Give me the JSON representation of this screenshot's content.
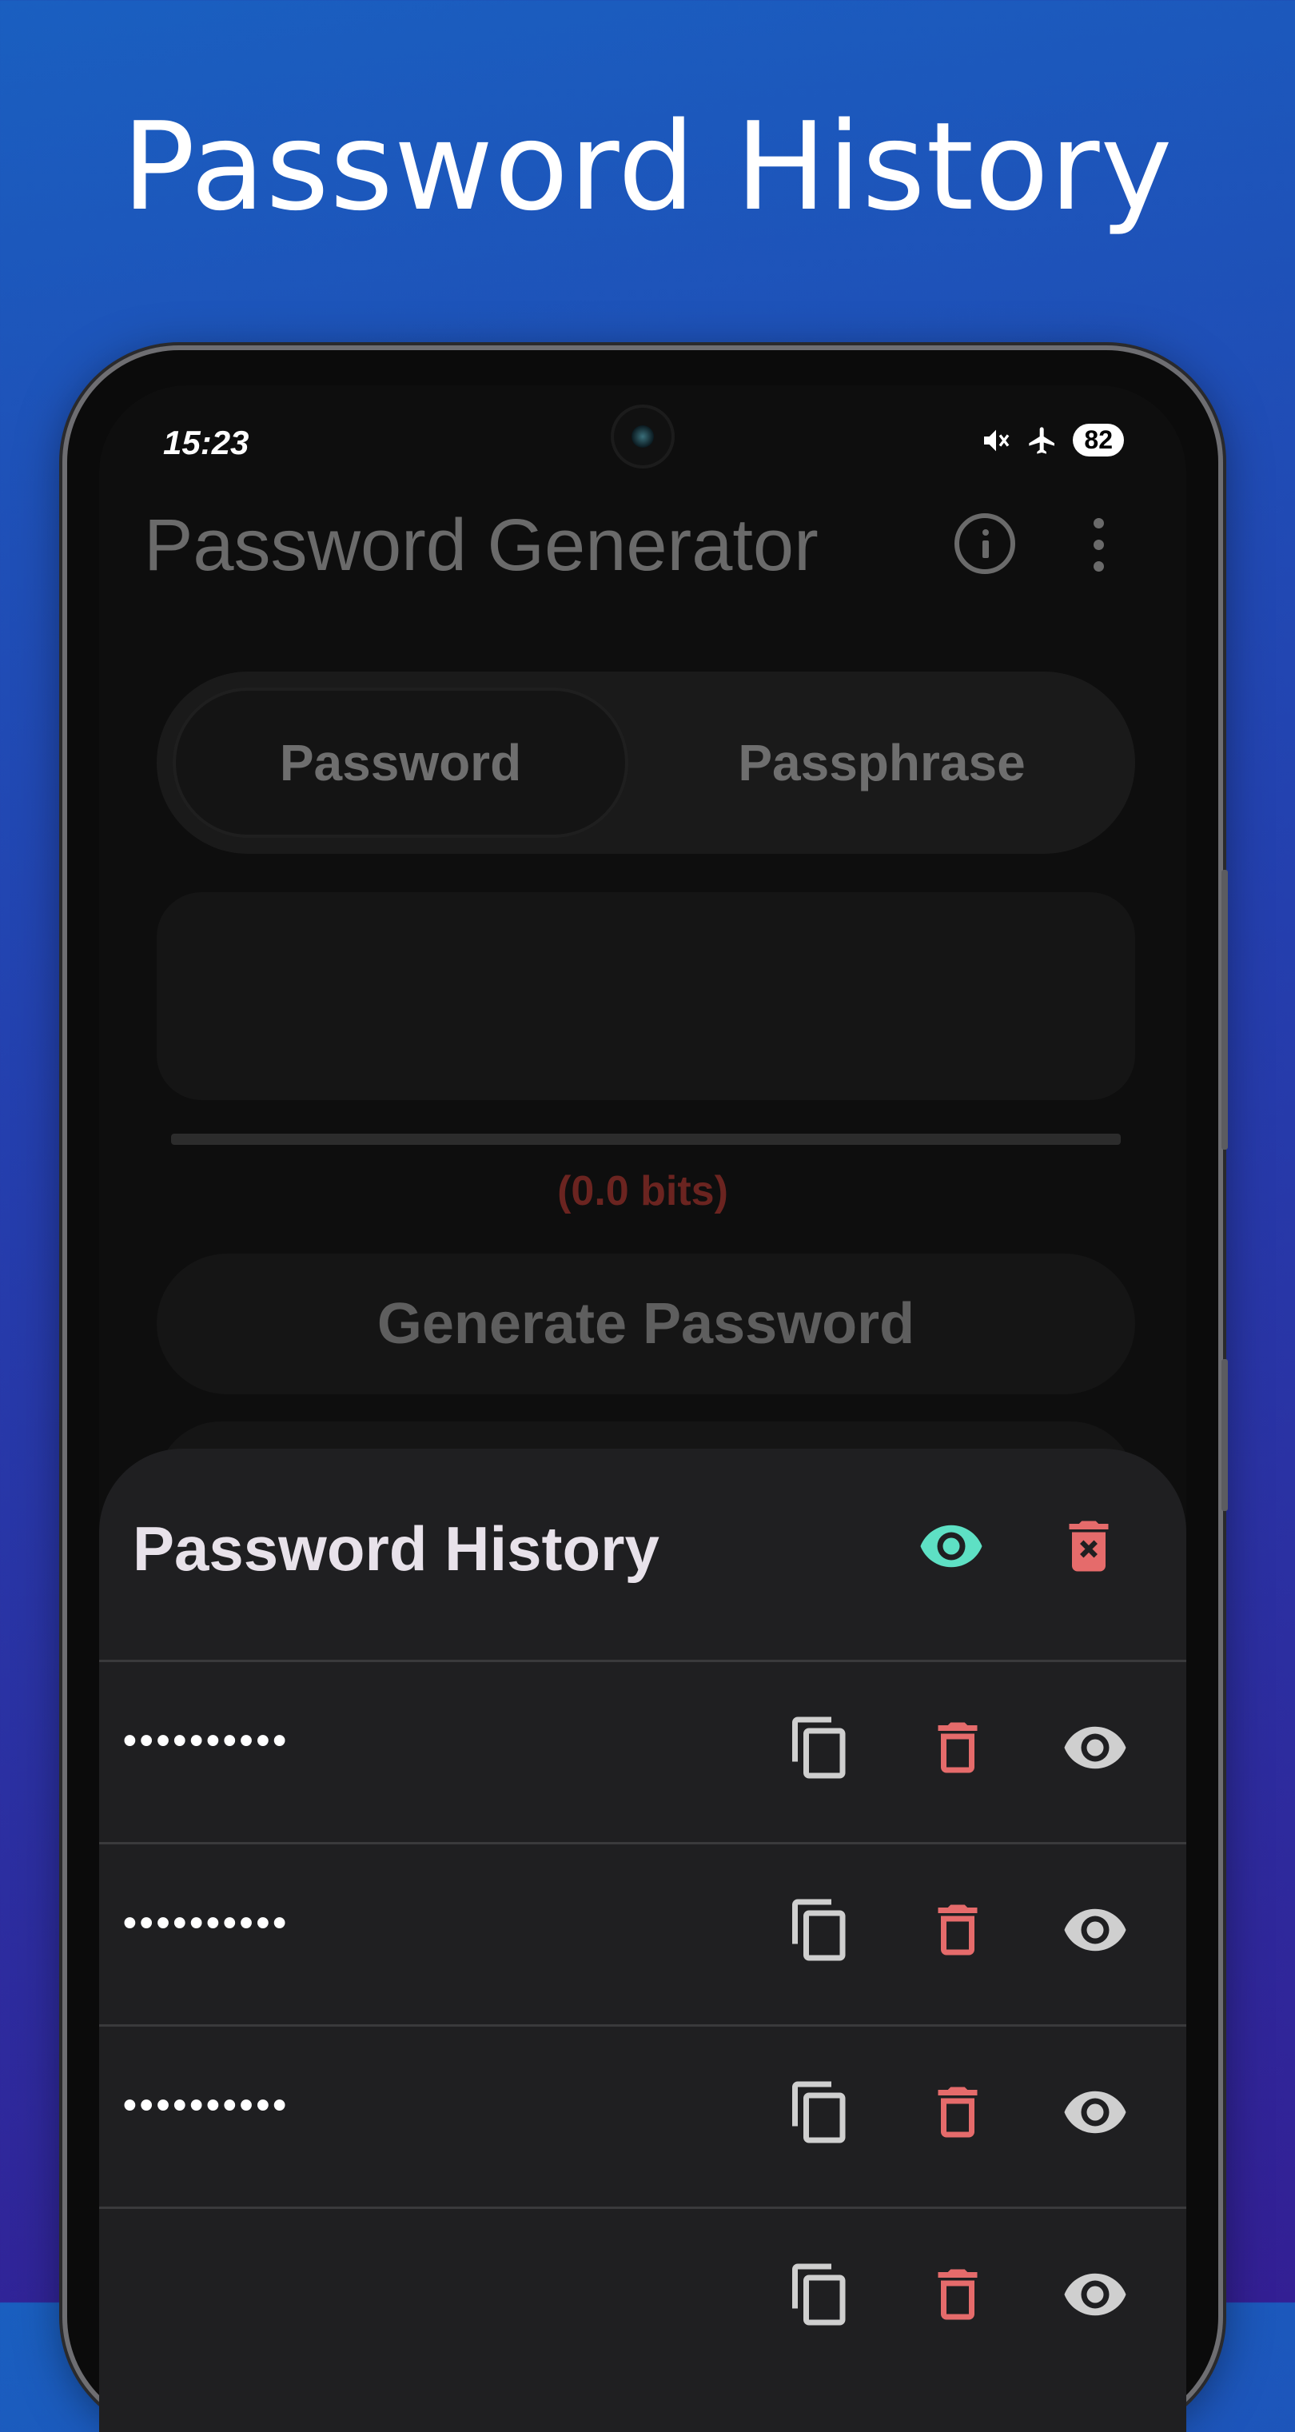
{
  "promo": {
    "title": "Password History"
  },
  "status_bar": {
    "time": "15:23",
    "battery": "82"
  },
  "app_bar": {
    "title": "Password Generator",
    "info_icon": "info-icon",
    "menu_icon": "more-vert-icon"
  },
  "mode_tabs": [
    {
      "label": "Password",
      "selected": true
    },
    {
      "label": "Passphrase",
      "selected": false
    }
  ],
  "generator": {
    "output": "",
    "strength_label": "(0.0 bits)",
    "generate_label": "Generate Password"
  },
  "history_sheet": {
    "title": "Password History",
    "toggle_visibility_icon": "eye-icon",
    "clear_all_icon": "delete-forever-icon",
    "items": [
      {
        "masked": "••••••••••"
      },
      {
        "masked": "••••••••••"
      },
      {
        "masked": "••••••••••"
      },
      {
        "masked": ""
      }
    ]
  },
  "colors": {
    "accent_teal": "#5ee0c4",
    "danger_red": "#e56b6b",
    "icon_gray": "#cfcfcf",
    "strength_red": "#6b2420"
  }
}
